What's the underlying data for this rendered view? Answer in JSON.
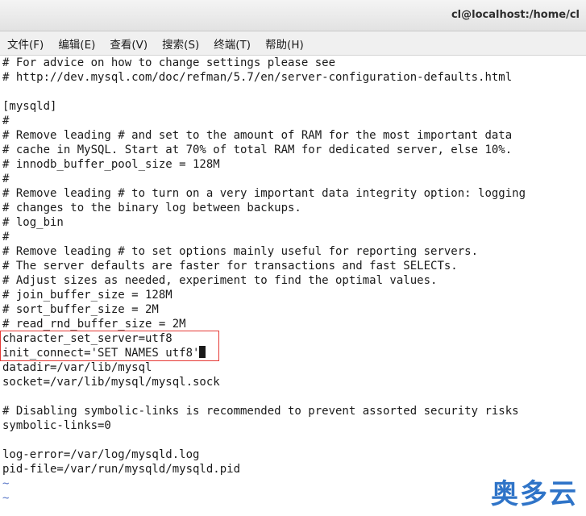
{
  "window": {
    "title": "cl@localhost:/home/cl"
  },
  "menu": {
    "items": [
      "文件(F)",
      "编辑(E)",
      "查看(V)",
      "搜索(S)",
      "终端(T)",
      "帮助(H)"
    ]
  },
  "terminal": {
    "lines": [
      "# For advice on how to change settings please see",
      "# http://dev.mysql.com/doc/refman/5.7/en/server-configuration-defaults.html",
      "",
      "[mysqld]",
      "#",
      "# Remove leading # and set to the amount of RAM for the most important data",
      "# cache in MySQL. Start at 70% of total RAM for dedicated server, else 10%.",
      "# innodb_buffer_pool_size = 128M",
      "#",
      "# Remove leading # to turn on a very important data integrity option: logging",
      "# changes to the binary log between backups.",
      "# log_bin",
      "#",
      "# Remove leading # to set options mainly useful for reporting servers.",
      "# The server defaults are faster for transactions and fast SELECTs.",
      "# Adjust sizes as needed, experiment to find the optimal values.",
      "# join_buffer_size = 128M",
      "# sort_buffer_size = 2M",
      "# read_rnd_buffer_size = 2M",
      "character_set_server=utf8",
      "init_connect='SET NAMES utf8'",
      "datadir=/var/lib/mysql",
      "socket=/var/lib/mysql/mysql.sock",
      "",
      "# Disabling symbolic-links is recommended to prevent assorted security risks",
      "symbolic-links=0",
      "",
      "log-error=/var/log/mysqld.log",
      "pid-file=/var/run/mysqld/mysqld.pid",
      "~",
      "~"
    ],
    "cursor_line": 20
  },
  "watermark": {
    "text": "奥多云"
  },
  "colors": {
    "highlight_border": "#e53935",
    "tilde": "#5a78c8",
    "watermark": "#2f74c8"
  }
}
